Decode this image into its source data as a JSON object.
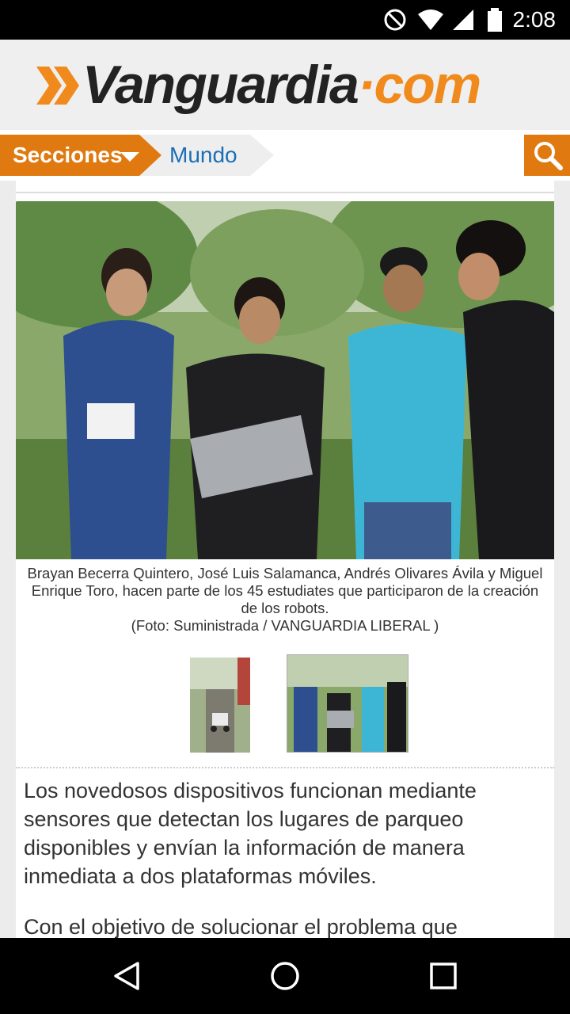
{
  "status_bar": {
    "time": "2:08",
    "icons": [
      "do-not-disturb-icon",
      "wifi-icon",
      "signal-icon",
      "battery-icon"
    ]
  },
  "header": {
    "logo_main": "Vanguardia",
    "logo_dot": "·",
    "logo_suffix": "com",
    "brand_color": "#f08a1c"
  },
  "nav": {
    "sections_label": "Secciones",
    "current_section": "Mundo",
    "search_icon": "search-icon"
  },
  "article": {
    "caption_line1": "Brayan Becerra Quintero, José Luis Salamanca, Andrés Olivares Ávila y Miguel",
    "caption_line2": "Enrique Toro, hacen parte de los 45 estudiates que participaron de la creación",
    "caption_line3": "de los robots.",
    "caption_credit": "(Foto: Suministrada / VANGUARDIA LIBERAL )",
    "paragraph1": "Los novedosos dispositivos funcionan mediante sensores que detectan los lugares de parqueo disponibles y envían la información de manera inmediata a dos plataformas móviles.",
    "paragraph2": "Con el objetivo de solucionar el problema que"
  },
  "system_nav": {
    "back_icon": "back-triangle-icon",
    "home_icon": "home-circle-icon",
    "recents_icon": "recents-square-icon"
  }
}
